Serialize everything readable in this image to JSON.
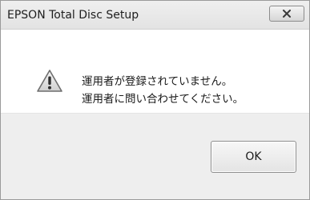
{
  "window": {
    "title": "EPSON Total Disc Setup"
  },
  "dialog": {
    "icon": "warning-icon",
    "message_lines": [
      "運用者が登録されていません。",
      "運用者に問い合わせてください。"
    ]
  },
  "buttons": {
    "ok_label": "OK",
    "close_icon": "close-icon"
  },
  "colors": {
    "warning_triangle": "#e9e9e9",
    "warning_border": "#6e6e6e",
    "footer_bg": "#eeeeee"
  }
}
